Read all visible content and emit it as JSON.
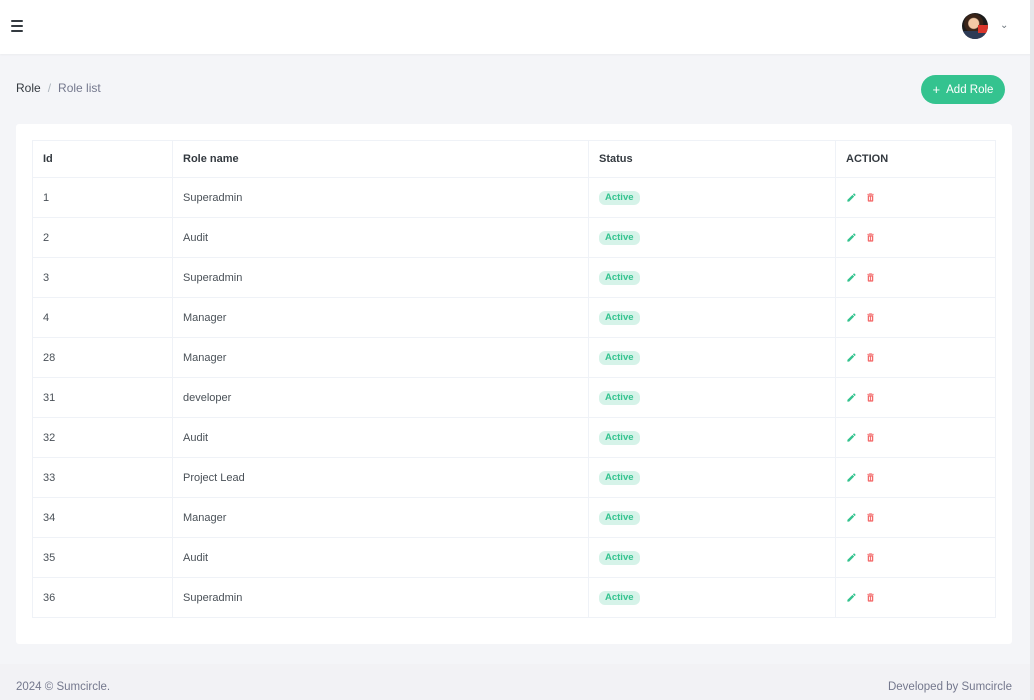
{
  "header": {
    "menu_icon": "hamburger-menu-icon",
    "user_avatar_icon": "user-avatar",
    "dropdown_icon": "chevron-down-icon",
    "chevron_glyph": "⌄"
  },
  "breadcrumb": {
    "root": "Role",
    "separator": "/",
    "current": "Role list"
  },
  "add_button": {
    "icon": "plus-icon",
    "plus_glyph": "+",
    "label": "Add Role"
  },
  "table": {
    "headers": {
      "id": "Id",
      "name": "Role name",
      "status": "Status",
      "action": "ACTION"
    },
    "rows": [
      {
        "id": "1",
        "name": "Superadmin",
        "status": "Active"
      },
      {
        "id": "2",
        "name": "Audit",
        "status": "Active"
      },
      {
        "id": "3",
        "name": "Superadmin",
        "status": "Active"
      },
      {
        "id": "4",
        "name": "Manager",
        "status": "Active"
      },
      {
        "id": "28",
        "name": "Manager",
        "status": "Active"
      },
      {
        "id": "31",
        "name": "developer",
        "status": "Active"
      },
      {
        "id": "32",
        "name": "Audit",
        "status": "Active"
      },
      {
        "id": "33",
        "name": "Project Lead",
        "status": "Active"
      },
      {
        "id": "34",
        "name": "Manager",
        "status": "Active"
      },
      {
        "id": "35",
        "name": "Audit",
        "status": "Active"
      },
      {
        "id": "36",
        "name": "Superadmin",
        "status": "Active"
      }
    ],
    "action_icons": [
      "pencil-edit-icon",
      "trash-delete-icon"
    ]
  },
  "colors": {
    "accent": "#34c38f",
    "danger": "#f46a6a",
    "badge_bg": "#d6f3e9"
  },
  "footer": {
    "left": "2024 © Sumcircle.",
    "right": "Developed by Sumcircle"
  }
}
